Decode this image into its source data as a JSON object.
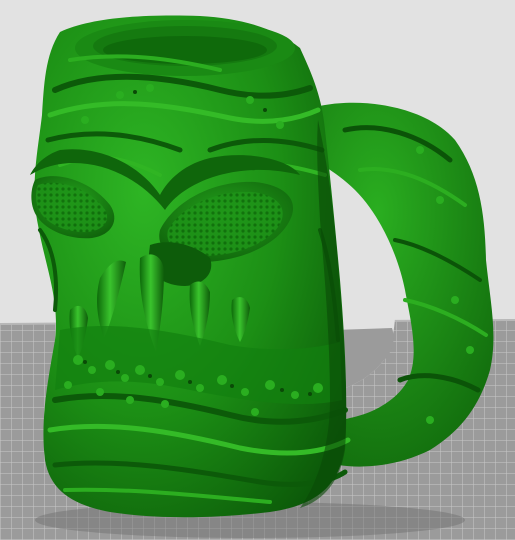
{
  "scene": {
    "kind": "3d-slicer-viewport",
    "model": "monster-face-mug",
    "colors": {
      "background": "#e2e2e2",
      "bed": "#9b9b9b",
      "grid": "#c8c8c8",
      "model_base": "#137d10",
      "model_highlight": "#2bb41f",
      "model_shadow": "#0a4a07"
    }
  }
}
